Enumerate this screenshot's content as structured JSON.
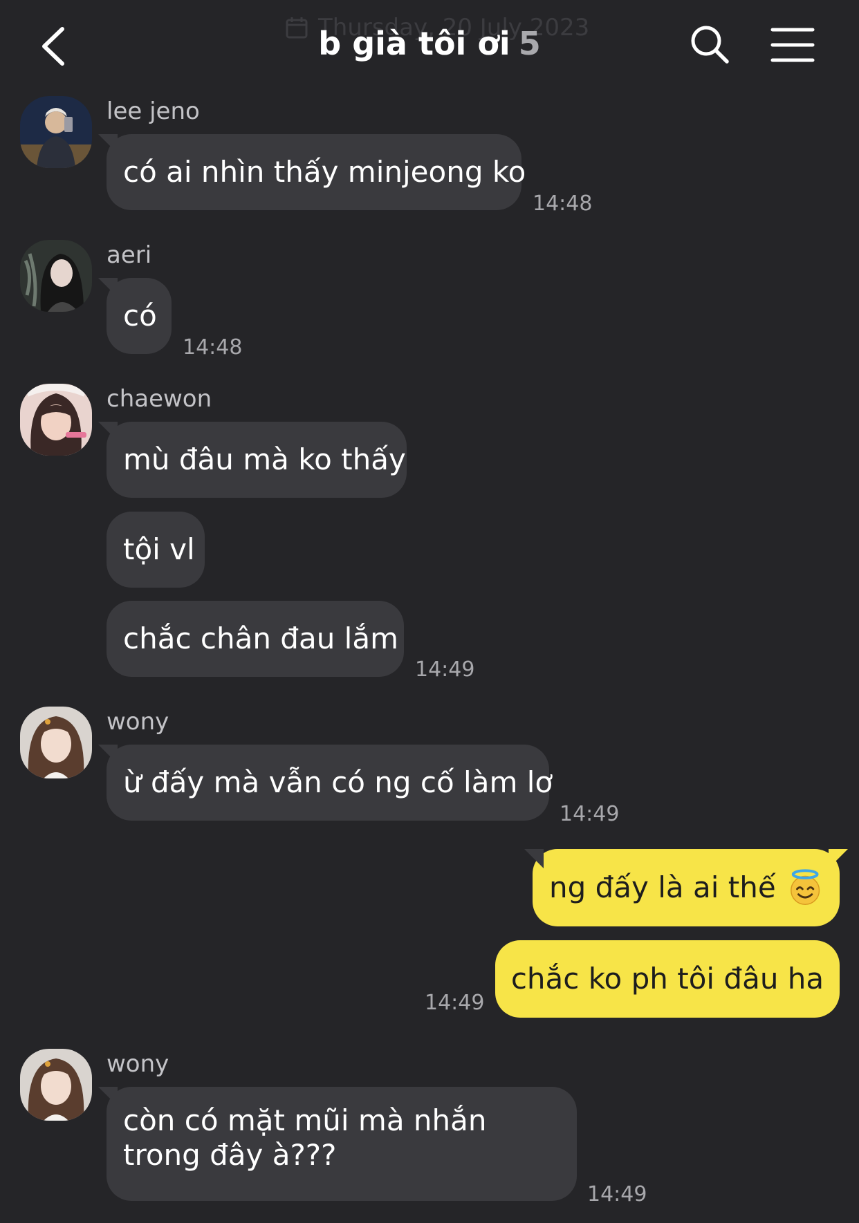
{
  "header": {
    "date_text": "Thursday, 20 July 2023",
    "title": "b già tôi ơi",
    "member_count": "5"
  },
  "messages": [
    {
      "sender": "lee jeno",
      "texts": [
        "có ai nhìn thấy minjeong ko"
      ],
      "time": "14:48"
    },
    {
      "sender": "aeri",
      "texts": [
        "có"
      ],
      "time": "14:48"
    },
    {
      "sender": "chaewon",
      "texts": [
        "mù đâu mà ko thấy",
        "tội vl",
        "chắc chân đau lắm"
      ],
      "time": "14:49"
    },
    {
      "sender": "wony",
      "texts": [
        "ừ đấy mà vẫn có ng cố làm lơ"
      ],
      "time": "14:49"
    },
    {
      "sender": "me",
      "texts": [
        "ng đấy là ai thế",
        "chắc ko ph tôi đâu ha"
      ],
      "time": "14:49"
    },
    {
      "sender": "wony",
      "texts": [
        "còn có mặt mũi mà nhắn trong đây à???"
      ],
      "time": "14:49"
    }
  ],
  "icons": {
    "back": "chevron-left-icon",
    "search": "search-icon",
    "menu": "hamburger-menu-icon",
    "date": "calendar-icon",
    "emoji": "smiling-face-with-halo"
  },
  "colors": {
    "background": "#252528",
    "incoming_bubble": "#3a3a3e",
    "outgoing_bubble": "#f7e448"
  }
}
